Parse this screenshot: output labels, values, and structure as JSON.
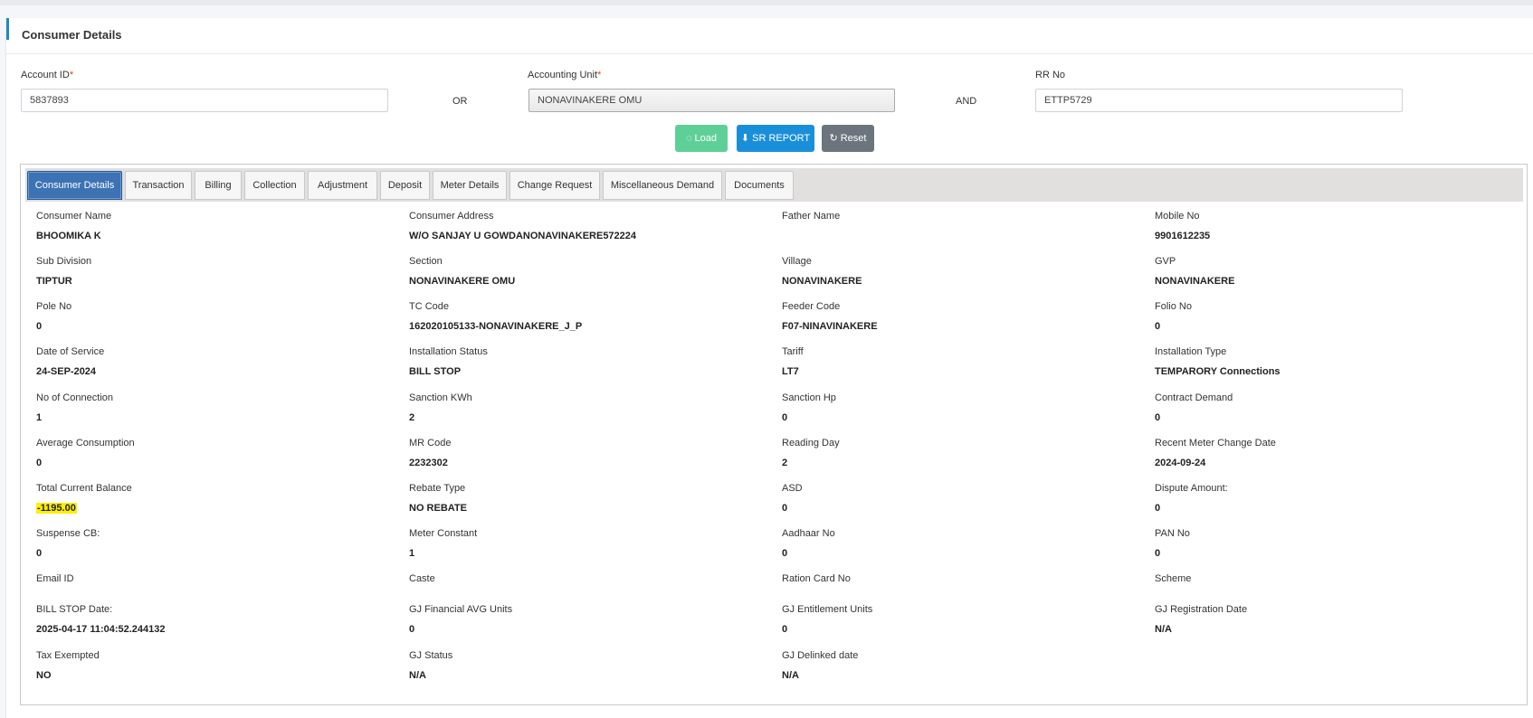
{
  "card": {
    "title": "Consumer Details"
  },
  "search": {
    "account_label": "Account ID",
    "account_value": "5837893",
    "or_text": "OR",
    "unit_label": "Accounting Unit",
    "unit_value": "NONAVINAKERE OMU",
    "and_text": "AND",
    "rr_label": "RR No",
    "rr_value": "ETTP5729",
    "required_mark": "*"
  },
  "buttons": {
    "load": "Load",
    "sr_report": "SR REPORT",
    "reset": "Reset"
  },
  "tabs": [
    "Consumer Details",
    "Transaction",
    "Billing",
    "Collection",
    "Adjustment",
    "Deposit",
    "Meter Details",
    "Change Request",
    "Miscellaneous Demand",
    "Documents"
  ],
  "details": [
    [
      {
        "label": "Consumer Name",
        "value": "BHOOMIKA K"
      },
      {
        "label": "Consumer Address",
        "value": "W/O SANJAY U GOWDANONAVINAKERE572224"
      },
      {
        "label": "Father Name",
        "value": ""
      },
      {
        "label": "Mobile No",
        "value": "9901612235"
      }
    ],
    [
      {
        "label": "Sub Division",
        "value": "TIPTUR"
      },
      {
        "label": "Section",
        "value": "NONAVINAKERE OMU"
      },
      {
        "label": "Village",
        "value": "NONAVINAKERE"
      },
      {
        "label": "GVP",
        "value": "NONAVINAKERE"
      }
    ],
    [
      {
        "label": "Pole No",
        "value": "0"
      },
      {
        "label": "TC Code",
        "value": "162020105133-NONAVINAKERE_J_P"
      },
      {
        "label": "Feeder Code",
        "value": "F07-NINAVINAKERE"
      },
      {
        "label": "Folio No",
        "value": "0"
      }
    ],
    [
      {
        "label": "Date of Service",
        "value": "24-SEP-2024"
      },
      {
        "label": "Installation Status",
        "value": "BILL STOP"
      },
      {
        "label": "Tariff",
        "value": "LT7"
      },
      {
        "label": "Installation Type",
        "value": "TEMPARORY Connections"
      }
    ],
    [
      {
        "label": "No of Connection",
        "value": "1"
      },
      {
        "label": "Sanction KWh",
        "value": "2"
      },
      {
        "label": "Sanction Hp",
        "value": "0"
      },
      {
        "label": "Contract Demand",
        "value": "0"
      }
    ],
    [
      {
        "label": "Average Consumption",
        "value": "0"
      },
      {
        "label": "MR Code",
        "value": "2232302"
      },
      {
        "label": "Reading Day",
        "value": "2"
      },
      {
        "label": "Recent Meter Change Date",
        "value": "2024-09-24"
      }
    ],
    [
      {
        "label": "Total Current Balance",
        "value": "-1195.00"
      },
      {
        "label": "Rebate Type",
        "value": "NO REBATE"
      },
      {
        "label": "ASD",
        "value": "0"
      },
      {
        "label": "Dispute Amount:",
        "value": "0"
      }
    ],
    [
      {
        "label": "Suspense CB:",
        "value": "0"
      },
      {
        "label": "Meter Constant",
        "value": "1"
      },
      {
        "label": "Aadhaar No",
        "value": "0"
      },
      {
        "label": "PAN No",
        "value": "0"
      }
    ],
    [
      {
        "label": "Email ID",
        "value": ""
      },
      {
        "label": "Caste",
        "value": ""
      },
      {
        "label": "Ration Card No",
        "value": ""
      },
      {
        "label": "Scheme",
        "value": ""
      }
    ],
    [
      {
        "label": "BILL STOP Date:",
        "value": "2025-04-17 11:04:52.244132"
      },
      {
        "label": "GJ Financial AVG Units",
        "value": "0"
      },
      {
        "label": "GJ Entitlement Units",
        "value": "0"
      },
      {
        "label": "GJ Registration Date",
        "value": "N/A"
      }
    ],
    [
      {
        "label": "Tax Exempted",
        "value": "NO"
      },
      {
        "label": "GJ Status",
        "value": "N/A"
      },
      {
        "label": "GJ Delinked date",
        "value": "N/A"
      },
      {
        "label": "",
        "value": ""
      }
    ]
  ],
  "colors": {
    "highlight": "#ffef00",
    "active_tab": "#3d73b4",
    "load": "#5fcf98",
    "sr_report": "#1a8fd9",
    "reset": "#6c757d"
  }
}
